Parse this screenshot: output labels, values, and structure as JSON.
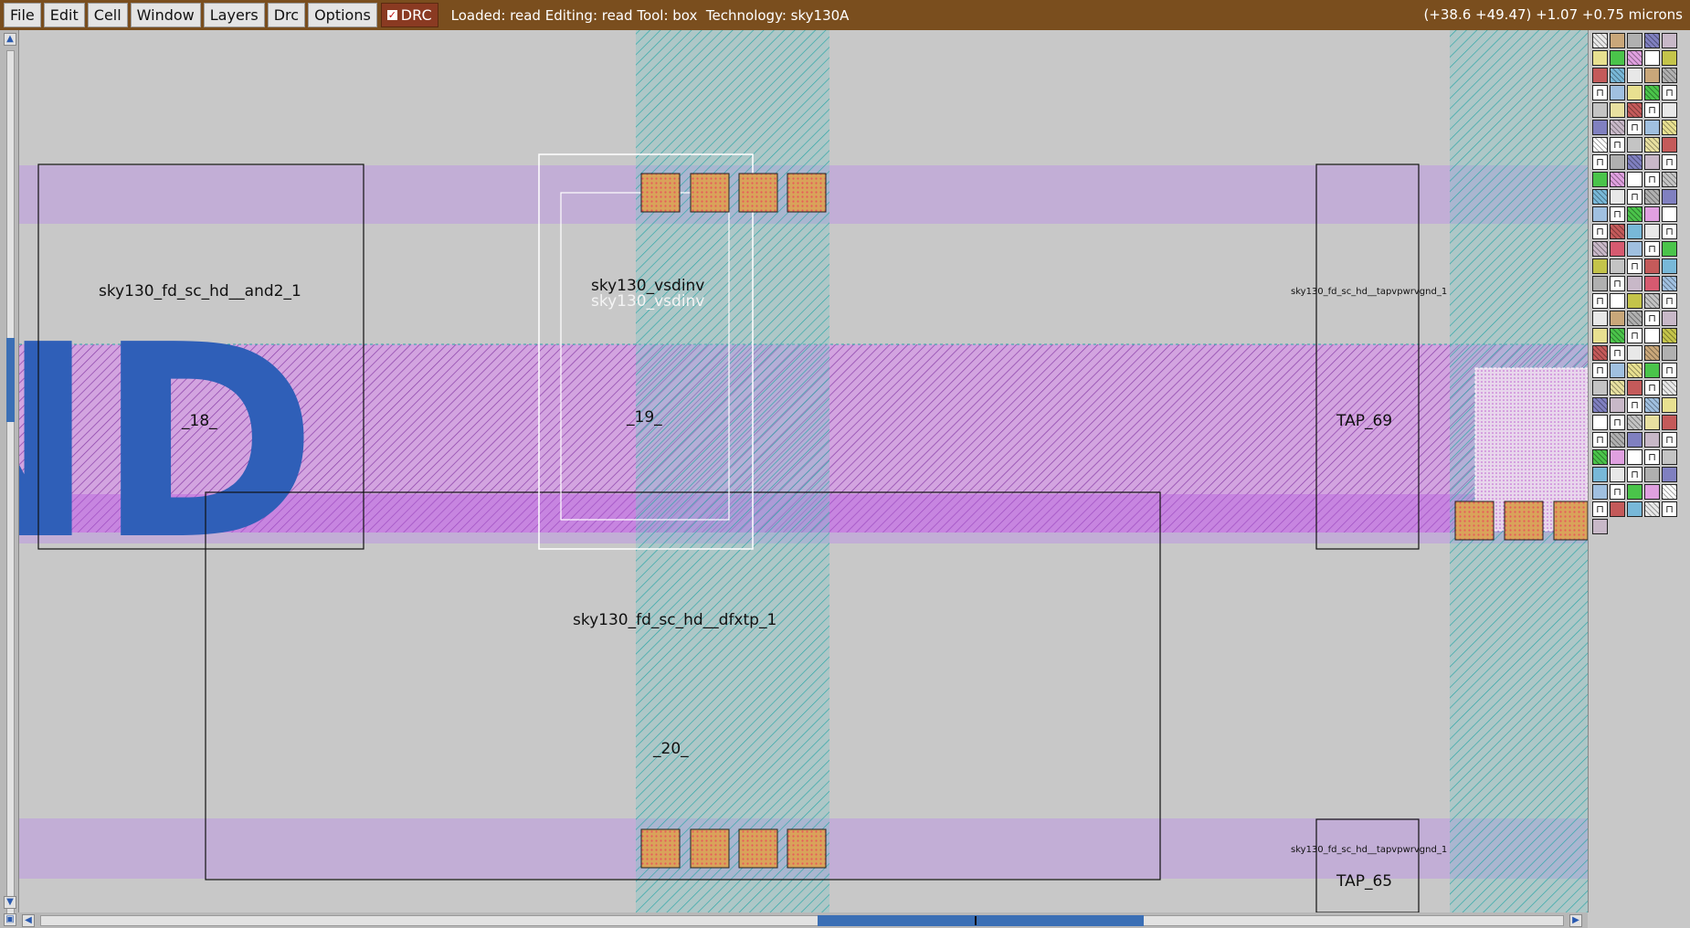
{
  "menubar": {
    "file": "File",
    "edit": "Edit",
    "cell": "Cell",
    "window": "Window",
    "layers": "Layers",
    "drc_menu": "Drc",
    "options": "Options",
    "drc_toggle": "DRC",
    "status": "Loaded: read Editing: read Tool: box  Technology: sky130A",
    "coords": "(+38.6 +49.47) +1.07 +0.75 microns"
  },
  "canvas": {
    "cell_and2": "sky130_fd_sc_hd__and2_1",
    "inst_18": "_18_",
    "cell_vsdinv": "sky130_vsdinv",
    "cell_vsdinv_shadow": "sky130_vsdinv",
    "inst_19": "_19_",
    "cell_dfxtp": "sky130_fd_sc_hd__dfxtp_1",
    "inst_20": "_20_",
    "cell_tap_top": "sky130_fd_sc_hd__tapvpwrvgnd_1",
    "tap_69": "TAP_69",
    "cell_tap_bottom": "sky130_fd_sc_hd__tapvpwrvgnd_1",
    "tap_65": "TAP_65",
    "big_label": "ND"
  },
  "scrollbars": {
    "vertical_position": 0.34,
    "horizontal_position": 0.51
  },
  "colors": {
    "menubar_bg": "#7a4e1e",
    "canvas_bg": "#c8c8c8",
    "nwell_band": "#c2aed6",
    "metal_hatch": "#c77ad8",
    "met1_stripe": "#4fa8a8",
    "label_blue": "#2f5fb8",
    "contact": "#d9a35a"
  }
}
